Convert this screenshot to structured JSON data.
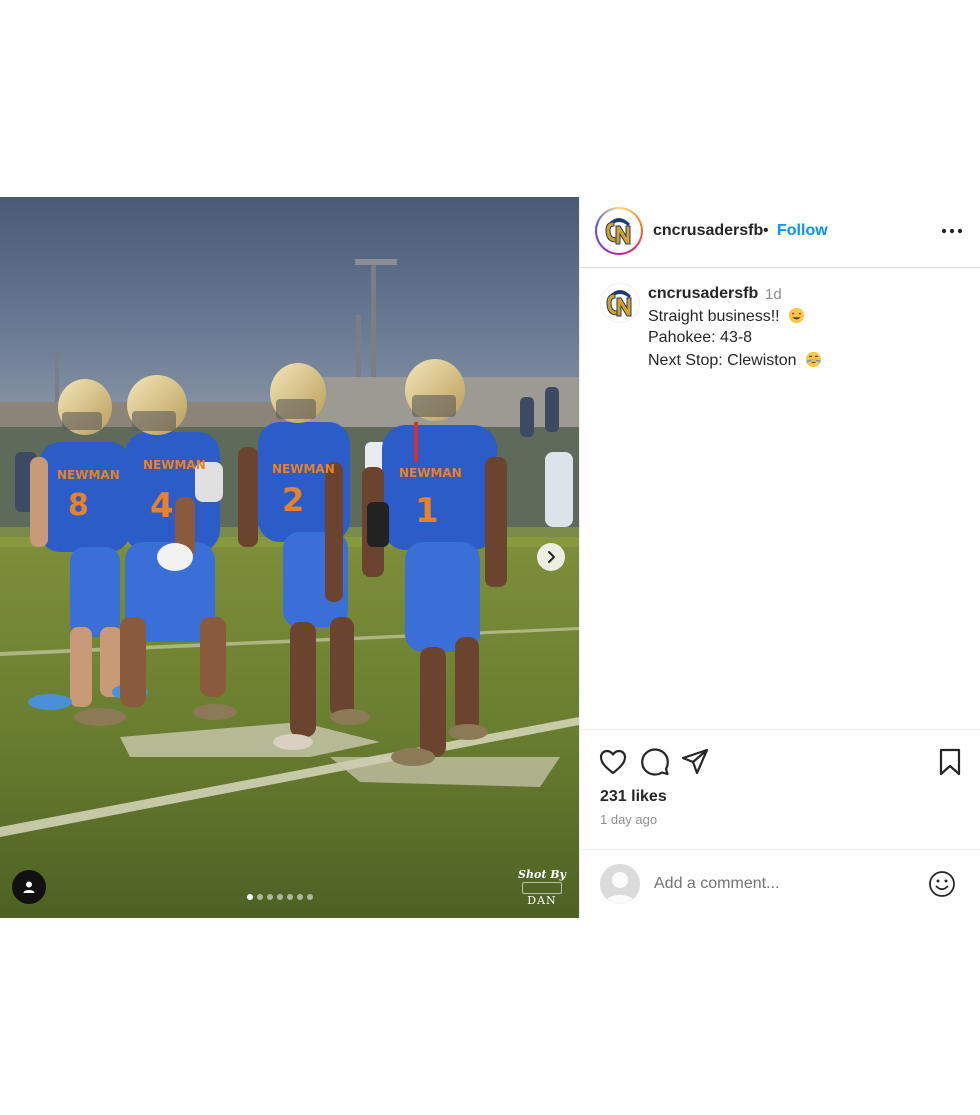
{
  "post": {
    "author": "cncrusadersfb",
    "follow_label": "Follow",
    "separator": "•",
    "avatar_icon": "crusaders-logo",
    "more_icon": "more-horizontal-icon"
  },
  "media": {
    "image_alt": "Four football players in blue and orange Newman jerseys walking on the field",
    "jersey_text": "NEWMAN",
    "jersey_numbers": [
      "8",
      "4",
      "2",
      "1"
    ],
    "carousel": {
      "total": 7,
      "active_index": 0
    },
    "watermark": {
      "line1": "Shot By",
      "line2": "DAN"
    },
    "next_icon": "chevron-right-icon",
    "tag_icon": "user-tag-icon"
  },
  "caption": {
    "username": "cncrusadersfb",
    "time": "1d",
    "lines": [
      {
        "text": "Straight business!!",
        "emoji": "smiling-heart-eyes-emoji"
      },
      {
        "text": "Pahokee: 43-8",
        "emoji": ""
      },
      {
        "text": "Next Stop: Clewiston",
        "emoji": "grinning-emoji"
      }
    ]
  },
  "actions": {
    "like_icon": "heart-icon",
    "comment_icon": "comment-icon",
    "share_icon": "send-icon",
    "save_icon": "bookmark-icon",
    "likes": "231 likes",
    "posted": "1 day ago"
  },
  "comment": {
    "placeholder": "Add a comment...",
    "emoji_icon": "smiley-icon"
  },
  "colors": {
    "follow": "#0095f6",
    "text": "#262626",
    "muted": "#8e8e8e",
    "jersey_blue": "#2b5cc7",
    "jersey_orange": "#e8822a"
  }
}
